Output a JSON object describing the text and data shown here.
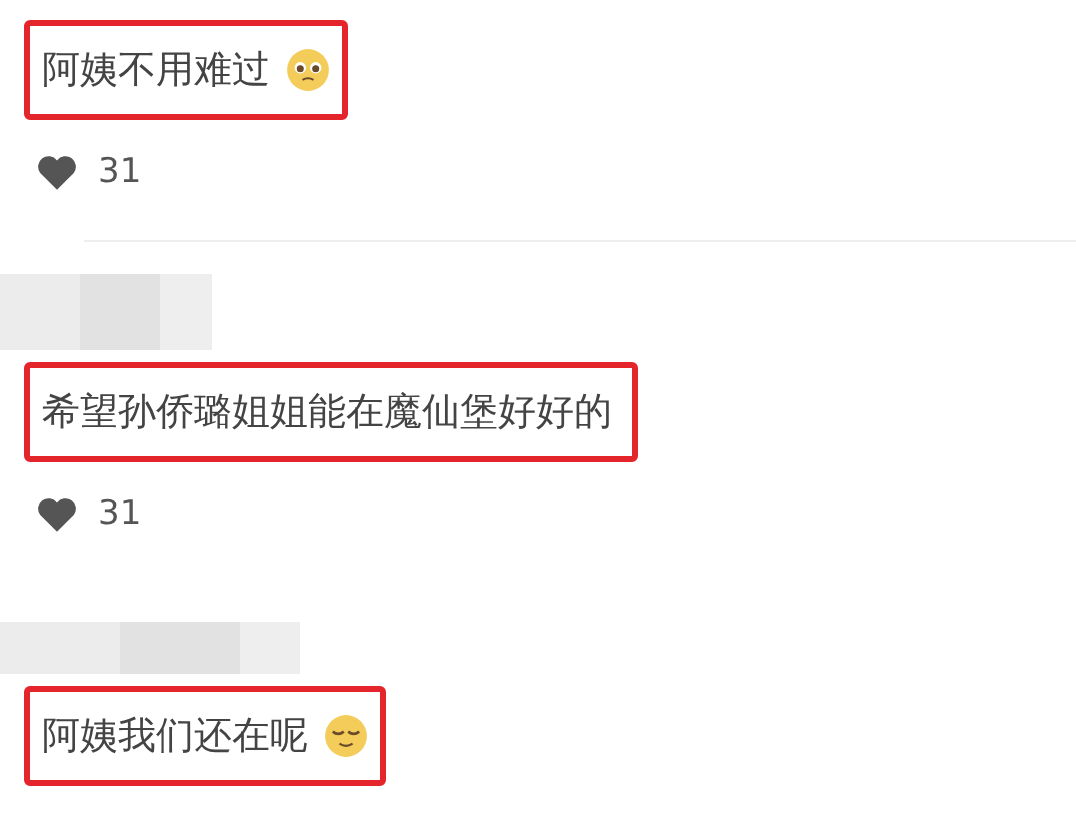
{
  "comments": [
    {
      "text": "阿姨不用难过",
      "emoji": {
        "kind": "pleading"
      },
      "highlighted": true,
      "likes": "31",
      "name_blurred": false
    },
    {
      "text": "希望孙侨璐姐姐能在魔仙堡好好的",
      "highlighted": true,
      "likes": "31",
      "name_blurred": true
    },
    {
      "text": "阿姨我们还在呢",
      "emoji": {
        "kind": "relieved"
      },
      "highlighted": true,
      "name_blurred": true
    }
  ]
}
